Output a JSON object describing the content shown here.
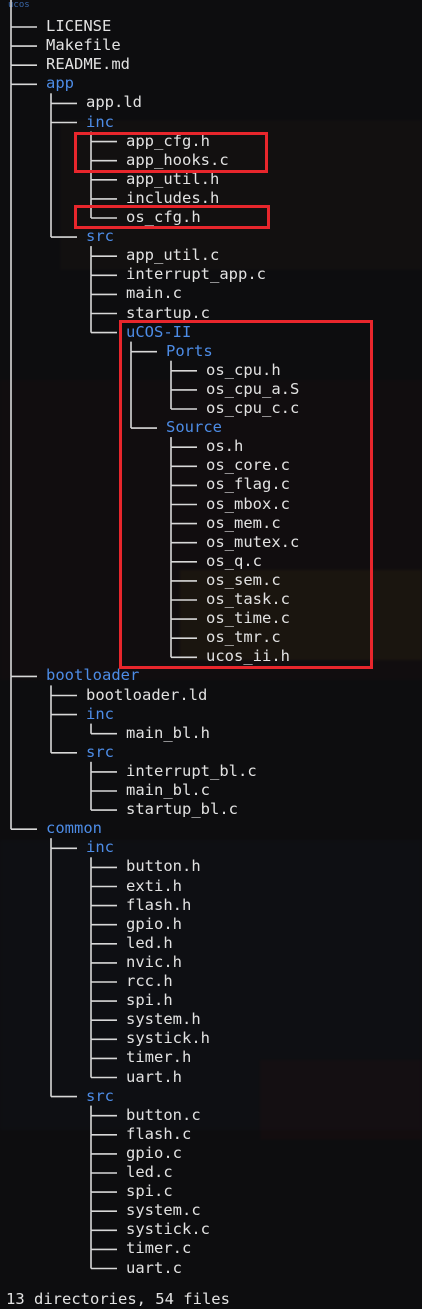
{
  "terminal": {
    "top_fragment": "ucos",
    "summary": "13 directories, 54 files",
    "colors": {
      "dir": "#4d8ce6",
      "file": "#e2e2e2",
      "highlight": "#e8262c",
      "tree_lines": "#d8d8d8"
    }
  },
  "tree": [
    {
      "name": "LICENSE",
      "depth": 0,
      "dir": false,
      "last": false
    },
    {
      "name": "Makefile",
      "depth": 0,
      "dir": false,
      "last": false
    },
    {
      "name": "README.md",
      "depth": 0,
      "dir": false,
      "last": false
    },
    {
      "name": "app",
      "depth": 0,
      "dir": true,
      "last": false
    },
    {
      "name": "app.ld",
      "depth": 1,
      "dir": false,
      "last": false
    },
    {
      "name": "inc",
      "depth": 1,
      "dir": true,
      "last": false
    },
    {
      "name": "app_cfg.h",
      "depth": 2,
      "dir": false,
      "last": false
    },
    {
      "name": "app_hooks.c",
      "depth": 2,
      "dir": false,
      "last": false
    },
    {
      "name": "app_util.h",
      "depth": 2,
      "dir": false,
      "last": false
    },
    {
      "name": "includes.h",
      "depth": 2,
      "dir": false,
      "last": false
    },
    {
      "name": "os_cfg.h",
      "depth": 2,
      "dir": false,
      "last": true
    },
    {
      "name": "src",
      "depth": 1,
      "dir": true,
      "last": true
    },
    {
      "name": "app_util.c",
      "depth": 2,
      "dir": false,
      "last": false
    },
    {
      "name": "interrupt_app.c",
      "depth": 2,
      "dir": false,
      "last": false
    },
    {
      "name": "main.c",
      "depth": 2,
      "dir": false,
      "last": false
    },
    {
      "name": "startup.c",
      "depth": 2,
      "dir": false,
      "last": false
    },
    {
      "name": "uCOS-II",
      "depth": 2,
      "dir": true,
      "last": true
    },
    {
      "name": "Ports",
      "depth": 3,
      "dir": true,
      "last": false
    },
    {
      "name": "os_cpu.h",
      "depth": 4,
      "dir": false,
      "last": false
    },
    {
      "name": "os_cpu_a.S",
      "depth": 4,
      "dir": false,
      "last": false
    },
    {
      "name": "os_cpu_c.c",
      "depth": 4,
      "dir": false,
      "last": true
    },
    {
      "name": "Source",
      "depth": 3,
      "dir": true,
      "last": true
    },
    {
      "name": "os.h",
      "depth": 4,
      "dir": false,
      "last": false
    },
    {
      "name": "os_core.c",
      "depth": 4,
      "dir": false,
      "last": false
    },
    {
      "name": "os_flag.c",
      "depth": 4,
      "dir": false,
      "last": false
    },
    {
      "name": "os_mbox.c",
      "depth": 4,
      "dir": false,
      "last": false
    },
    {
      "name": "os_mem.c",
      "depth": 4,
      "dir": false,
      "last": false
    },
    {
      "name": "os_mutex.c",
      "depth": 4,
      "dir": false,
      "last": false
    },
    {
      "name": "os_q.c",
      "depth": 4,
      "dir": false,
      "last": false
    },
    {
      "name": "os_sem.c",
      "depth": 4,
      "dir": false,
      "last": false
    },
    {
      "name": "os_task.c",
      "depth": 4,
      "dir": false,
      "last": false
    },
    {
      "name": "os_time.c",
      "depth": 4,
      "dir": false,
      "last": false
    },
    {
      "name": "os_tmr.c",
      "depth": 4,
      "dir": false,
      "last": false
    },
    {
      "name": "ucos_ii.h",
      "depth": 4,
      "dir": false,
      "last": true
    },
    {
      "name": "bootloader",
      "depth": 0,
      "dir": true,
      "last": false
    },
    {
      "name": "bootloader.ld",
      "depth": 1,
      "dir": false,
      "last": false
    },
    {
      "name": "inc",
      "depth": 1,
      "dir": true,
      "last": false
    },
    {
      "name": "main_bl.h",
      "depth": 2,
      "dir": false,
      "last": true
    },
    {
      "name": "src",
      "depth": 1,
      "dir": true,
      "last": true
    },
    {
      "name": "interrupt_bl.c",
      "depth": 2,
      "dir": false,
      "last": false
    },
    {
      "name": "main_bl.c",
      "depth": 2,
      "dir": false,
      "last": false
    },
    {
      "name": "startup_bl.c",
      "depth": 2,
      "dir": false,
      "last": true
    },
    {
      "name": "common",
      "depth": 0,
      "dir": true,
      "last": true
    },
    {
      "name": "inc",
      "depth": 1,
      "dir": true,
      "last": false
    },
    {
      "name": "button.h",
      "depth": 2,
      "dir": false,
      "last": false
    },
    {
      "name": "exti.h",
      "depth": 2,
      "dir": false,
      "last": false
    },
    {
      "name": "flash.h",
      "depth": 2,
      "dir": false,
      "last": false
    },
    {
      "name": "gpio.h",
      "depth": 2,
      "dir": false,
      "last": false
    },
    {
      "name": "led.h",
      "depth": 2,
      "dir": false,
      "last": false
    },
    {
      "name": "nvic.h",
      "depth": 2,
      "dir": false,
      "last": false
    },
    {
      "name": "rcc.h",
      "depth": 2,
      "dir": false,
      "last": false
    },
    {
      "name": "spi.h",
      "depth": 2,
      "dir": false,
      "last": false
    },
    {
      "name": "system.h",
      "depth": 2,
      "dir": false,
      "last": false
    },
    {
      "name": "systick.h",
      "depth": 2,
      "dir": false,
      "last": false
    },
    {
      "name": "timer.h",
      "depth": 2,
      "dir": false,
      "last": false
    },
    {
      "name": "uart.h",
      "depth": 2,
      "dir": false,
      "last": true
    },
    {
      "name": "src",
      "depth": 1,
      "dir": true,
      "last": true
    },
    {
      "name": "button.c",
      "depth": 2,
      "dir": false,
      "last": false
    },
    {
      "name": "flash.c",
      "depth": 2,
      "dir": false,
      "last": false
    },
    {
      "name": "gpio.c",
      "depth": 2,
      "dir": false,
      "last": false
    },
    {
      "name": "led.c",
      "depth": 2,
      "dir": false,
      "last": false
    },
    {
      "name": "spi.c",
      "depth": 2,
      "dir": false,
      "last": false
    },
    {
      "name": "system.c",
      "depth": 2,
      "dir": false,
      "last": false
    },
    {
      "name": "systick.c",
      "depth": 2,
      "dir": false,
      "last": false
    },
    {
      "name": "timer.c",
      "depth": 2,
      "dir": false,
      "last": false
    },
    {
      "name": "uart.c",
      "depth": 2,
      "dir": false,
      "last": true
    }
  ],
  "highlights": [
    {
      "label": "app-hooks-highlight"
    },
    {
      "label": "os-cfg-highlight"
    },
    {
      "label": "ucos-ii-highlight"
    }
  ]
}
